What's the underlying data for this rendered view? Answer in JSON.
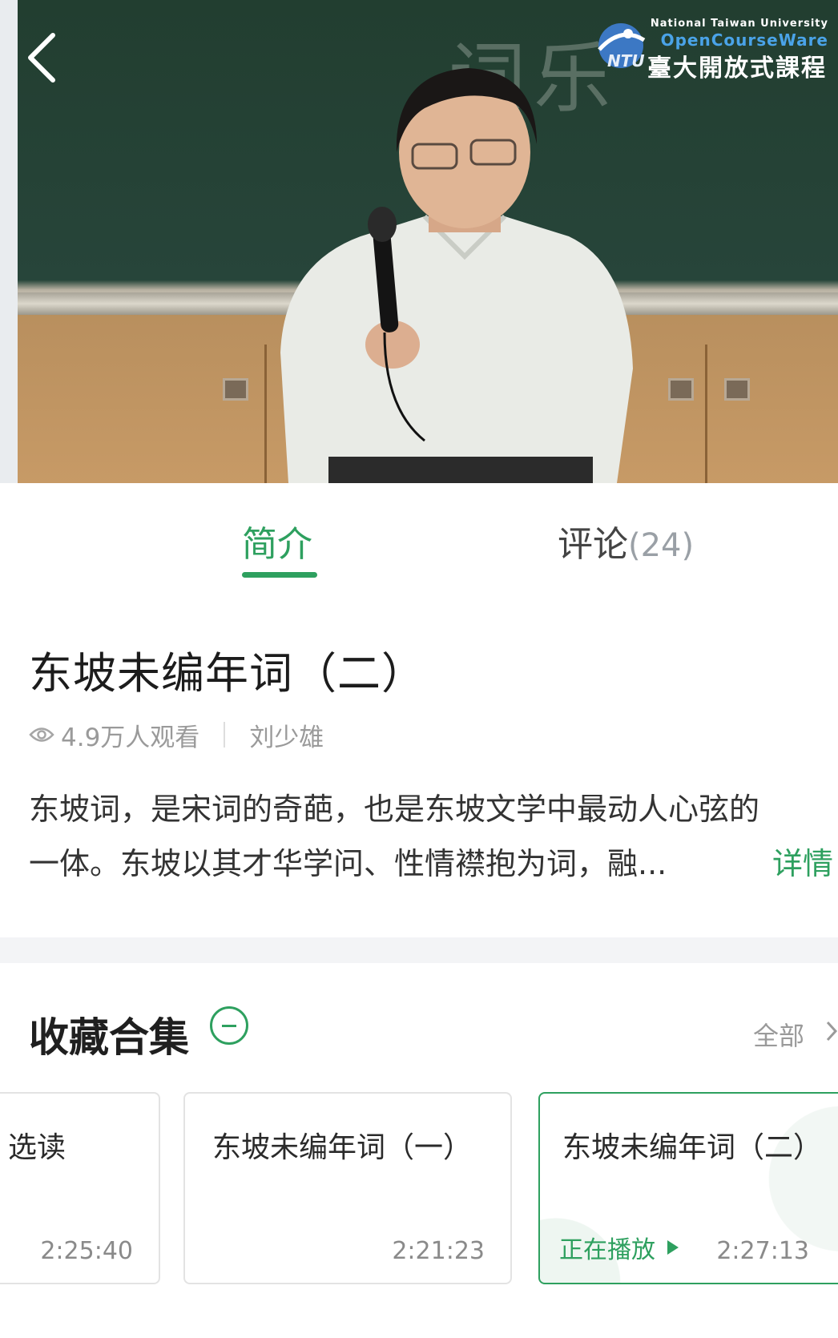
{
  "video": {
    "logo_en_top": "National Taiwan University",
    "logo_en_sub": "OpenCourseWare",
    "logo_zh": "臺大開放式課程",
    "logo_mark": "NTU"
  },
  "tabs": {
    "intro": "简介",
    "comments": "评论",
    "comments_count": "(24)"
  },
  "lecture": {
    "title": "东坡未编年词（二）",
    "views": "4.9万人观看",
    "author": "刘少雄",
    "desc_line1": "东坡词，是宋词的奇葩，也是东坡文学中最动人心弦的",
    "desc_line2": "一体。东坡以其才华学问、性情襟抱为词，融...",
    "more_label": "详情"
  },
  "collection": {
    "title": "收藏合集",
    "all_label": "全部",
    "items": [
      {
        "title": "选读",
        "duration": "2:25:40"
      },
      {
        "title": "东坡未编年词（一）",
        "duration": "2:21:23"
      },
      {
        "title": "东坡未编年词（二）",
        "duration": "2:27:13",
        "status": "正在播放"
      }
    ]
  },
  "colors": {
    "accent": "#2ea05f",
    "muted": "#9a9a9a"
  }
}
